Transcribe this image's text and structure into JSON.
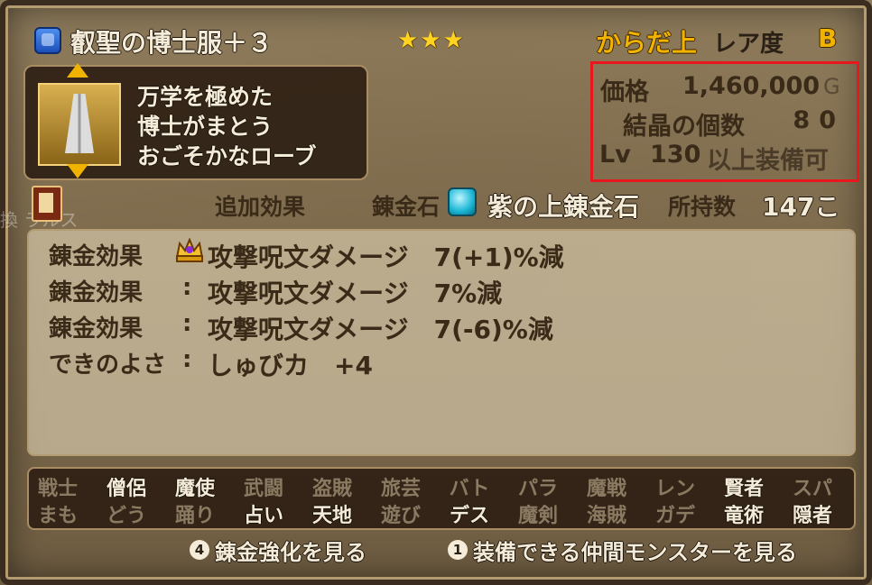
{
  "item": {
    "name": "叡聖の博士服＋３",
    "stars": "★★★",
    "slot": "からだ上",
    "rarity_label": "レア度",
    "rarity_value": "B",
    "description": [
      "万学を極めた",
      "博士がまとう",
      "おごそかなローブ"
    ]
  },
  "stats": {
    "price_label": "価格",
    "price_value": "1,460,000",
    "price_unit": "G",
    "crystal_label": "結晶の個数",
    "crystal_value": "80",
    "level_prefix": "Lv",
    "level_value": "130",
    "level_suffix": "以上装備可"
  },
  "alchemy_header": {
    "extra_effect": "追加効果",
    "stone_label": "錬金石",
    "stone_name": "紫の上錬金石",
    "owned_label": "所持数",
    "owned_value": "147こ",
    "background_text": "換 ラルス"
  },
  "effects": [
    {
      "label": "錬金効果",
      "sep": "",
      "text": "攻撃呪文ダメージ　7(+1)%減",
      "icon": "crown-icon"
    },
    {
      "label": "錬金効果",
      "sep": ":",
      "text": "攻撃呪文ダメージ　7%減"
    },
    {
      "label": "錬金効果",
      "sep": ":",
      "text": "攻撃呪文ダメージ　7(-6)%減"
    },
    {
      "label": "できのよさ",
      "sep": ":",
      "text": "しゅびカ　+4"
    }
  ],
  "jobs_row1": [
    {
      "label": "戦士",
      "equippable": false
    },
    {
      "label": "僧侶",
      "equippable": true
    },
    {
      "label": "魔使",
      "equippable": true
    },
    {
      "label": "武闘",
      "equippable": false
    },
    {
      "label": "盗賊",
      "equippable": false
    },
    {
      "label": "旅芸",
      "equippable": false
    },
    {
      "label": "バト",
      "equippable": false
    },
    {
      "label": "パラ",
      "equippable": false
    },
    {
      "label": "魔戦",
      "equippable": false
    },
    {
      "label": "レン",
      "equippable": false
    },
    {
      "label": "賢者",
      "equippable": true
    },
    {
      "label": "スパ",
      "equippable": false
    }
  ],
  "jobs_row2": [
    {
      "label": "まも",
      "equippable": false
    },
    {
      "label": "どう",
      "equippable": false
    },
    {
      "label": "踊り",
      "equippable": false
    },
    {
      "label": "占い",
      "equippable": true
    },
    {
      "label": "天地",
      "equippable": true
    },
    {
      "label": "遊び",
      "equippable": false
    },
    {
      "label": "デス",
      "equippable": true
    },
    {
      "label": "魔剣",
      "equippable": false
    },
    {
      "label": "海賊",
      "equippable": false
    },
    {
      "label": "ガデ",
      "equippable": false
    },
    {
      "label": "竜術",
      "equippable": true
    },
    {
      "label": "隠者",
      "equippable": true
    }
  ],
  "buttons": {
    "alchemy_num": "4",
    "alchemy": "錬金強化を見る",
    "monster_num": "1",
    "monster": "装備できる仲間モンスターを見る"
  },
  "colors": {
    "accent_gold": "#f2b300",
    "highlight_red": "#e8161d",
    "stone_cyan": "#19b6d4"
  }
}
